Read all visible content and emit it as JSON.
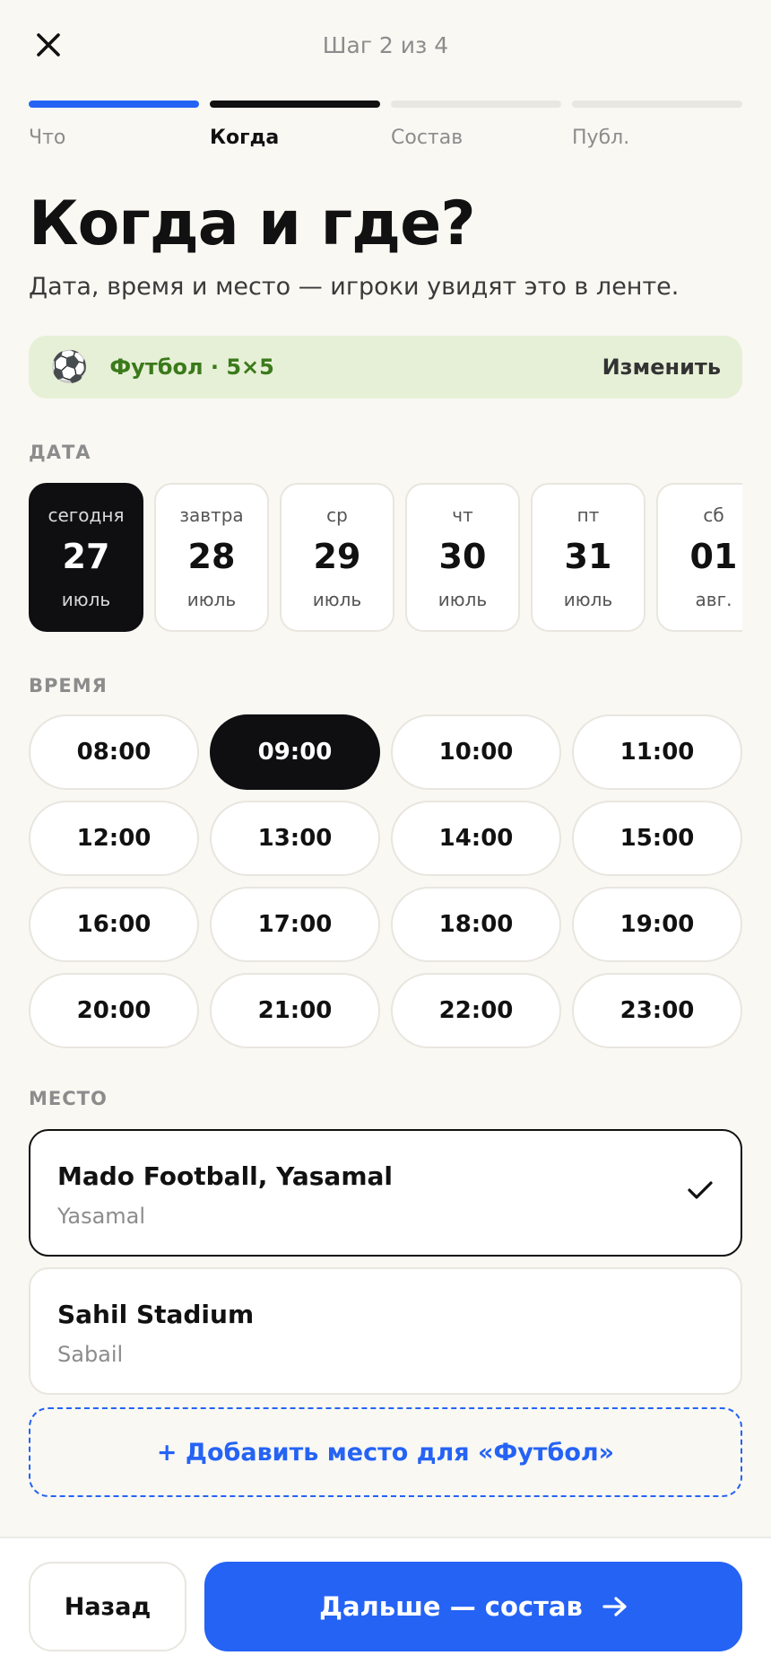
{
  "header": {
    "step_counter": "Шаг 2 из 4"
  },
  "progress": {
    "steps": [
      {
        "label": "Что",
        "state": "done"
      },
      {
        "label": "Когда",
        "state": "current"
      },
      {
        "label": "Состав",
        "state": "upcoming"
      },
      {
        "label": "Публ.",
        "state": "upcoming"
      }
    ]
  },
  "page": {
    "title": "Когда и где?",
    "subtitle": "Дата, время и место — игроки увидят это в ленте."
  },
  "sport_banner": {
    "icon": "soccer-ball-icon",
    "text": "Футбол · 5×5",
    "change_label": "Изменить"
  },
  "date_section": {
    "label": "ДАТА",
    "selected_index": 0,
    "dates": [
      {
        "dow": "сегодня",
        "day": "27",
        "month": "июль"
      },
      {
        "dow": "завтра",
        "day": "28",
        "month": "июль"
      },
      {
        "dow": "ср",
        "day": "29",
        "month": "июль"
      },
      {
        "dow": "чт",
        "day": "30",
        "month": "июль"
      },
      {
        "dow": "пт",
        "day": "31",
        "month": "июль"
      },
      {
        "dow": "сб",
        "day": "01",
        "month": "авг."
      }
    ]
  },
  "time_section": {
    "label": "ВРЕМЯ",
    "selected": "09:00",
    "slots": [
      "08:00",
      "09:00",
      "10:00",
      "11:00",
      "12:00",
      "13:00",
      "14:00",
      "15:00",
      "16:00",
      "17:00",
      "18:00",
      "19:00",
      "20:00",
      "21:00",
      "22:00",
      "23:00"
    ]
  },
  "place_section": {
    "label": "МЕСТО",
    "venues": [
      {
        "name": "Mado Football, Yasamal",
        "area": "Yasamal",
        "selected": true
      },
      {
        "name": "Sahil Stadium",
        "area": "Sabail",
        "selected": false
      }
    ],
    "add_label": "+ Добавить место для «Футбол»"
  },
  "footer": {
    "back_label": "Назад",
    "next_label": "Дальше — состав"
  },
  "colors": {
    "accent": "#2563f5",
    "dark": "#0f0f12",
    "sport_bg": "#e6f0d6",
    "sport_text": "#3b7a1b",
    "background": "#f9f8f3"
  }
}
